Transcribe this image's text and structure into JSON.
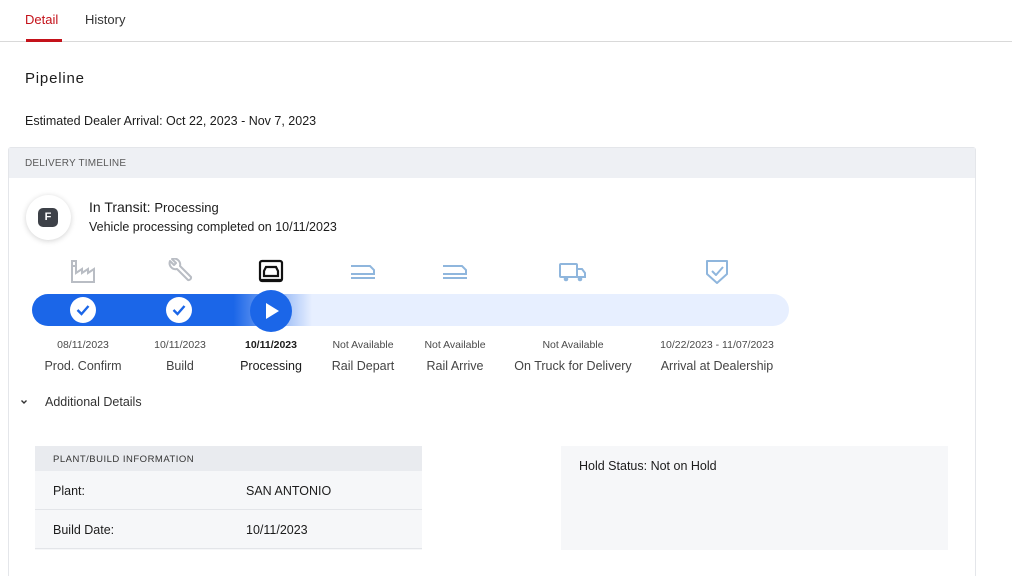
{
  "tabs": [
    {
      "label": "Detail",
      "active": true
    },
    {
      "label": "History",
      "active": false
    }
  ],
  "pipeline": {
    "title": "Pipeline",
    "estimated_arrival": "Estimated Dealer Arrival: Oct 22, 2023 - Nov 7, 2023"
  },
  "timeline": {
    "header": "DELIVERY TIMELINE",
    "badge_letter": "F",
    "status_prefix": "In Transit:",
    "status_value": "Processing",
    "status_detail": "Vehicle processing completed on 10/11/2023",
    "progress_steps_completed": 3,
    "steps": [
      {
        "icon": "factory-icon",
        "date": "08/11/2023",
        "label": "Prod. Confirm",
        "state": "done"
      },
      {
        "icon": "wrench-icon",
        "date": "10/11/2023",
        "label": "Build",
        "state": "done"
      },
      {
        "icon": "vehicle-processing-icon",
        "date": "10/11/2023",
        "label": "Processing",
        "state": "current"
      },
      {
        "icon": "rail-depart-icon",
        "date": "Not Available",
        "label": "Rail Depart",
        "state": "pending"
      },
      {
        "icon": "rail-arrive-icon",
        "date": "Not Available",
        "label": "Rail Arrive",
        "state": "pending"
      },
      {
        "icon": "truck-icon",
        "date": "Not Available",
        "label": "On Truck for Delivery",
        "state": "pending"
      },
      {
        "icon": "shield-check-icon",
        "date": "10/22/2023 - 11/07/2023",
        "label": "Arrival at Dealership",
        "state": "pending"
      }
    ]
  },
  "additional": {
    "toggle_label": "Additional Details",
    "plant_header": "PLANT/BUILD INFORMATION",
    "rows": [
      {
        "key": "Plant:",
        "value": "SAN ANTONIO"
      },
      {
        "key": "Build Date:",
        "value": "10/11/2023"
      }
    ],
    "hold_status": "Hold Status: Not on Hold"
  },
  "colors": {
    "accent_red": "#c4121a",
    "progress_blue": "#1b66e8",
    "track_light": "#e7efff",
    "pending_icon": "#8fb6dd"
  }
}
